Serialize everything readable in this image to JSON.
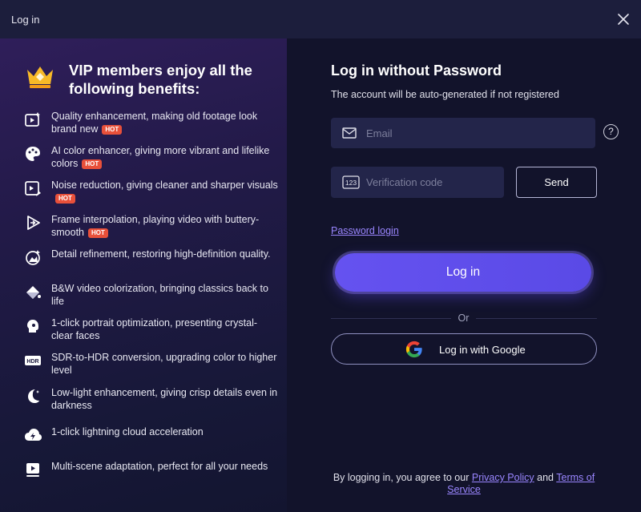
{
  "window": {
    "title": "Log in"
  },
  "benefits_panel": {
    "heading": "VIP members enjoy all the following benefits:",
    "hot_label": "HOT",
    "items": [
      {
        "icon": "video-enhance-icon",
        "text": "Quality enhancement, making old footage look brand new",
        "hot": true
      },
      {
        "icon": "palette-icon",
        "text": "AI color enhancer, giving more vibrant and lifelike colors",
        "hot": true
      },
      {
        "icon": "noise-reduction-icon",
        "text": "Noise reduction, giving cleaner and sharper visuals",
        "hot": true
      },
      {
        "icon": "frame-interpolation-icon",
        "text": "Frame interpolation, playing video with buttery-smooth",
        "hot": true
      },
      {
        "icon": "detail-refine-icon",
        "text": "Detail refinement, restoring high-definition quality.",
        "hot": false
      },
      {
        "icon": "colorize-icon",
        "text": "B&W video colorization, bringing classics back to life",
        "hot": false
      },
      {
        "icon": "portrait-icon",
        "text": "1-click portrait optimization, presenting crystal-clear faces",
        "hot": false
      },
      {
        "icon": "hdr-icon",
        "text": "SDR-to-HDR conversion, upgrading color to higher level",
        "hot": false
      },
      {
        "icon": "moon-icon",
        "text": "Low-light enhancement, giving crisp details even in darkness",
        "hot": false
      },
      {
        "icon": "cloud-lightning-icon",
        "text": "1-click lightning cloud acceleration",
        "hot": false
      },
      {
        "icon": "multi-scene-icon",
        "text": "Multi-scene adaptation, perfect for all your needs",
        "hot": false
      }
    ]
  },
  "login_panel": {
    "title": "Log in without Password",
    "subtitle": "The account will be auto-generated if not registered",
    "email": {
      "placeholder": "Email",
      "value": ""
    },
    "help_glyph": "?",
    "code": {
      "placeholder": "Verification code",
      "value": "",
      "icon_text": "123"
    },
    "send_label": "Send",
    "password_login_label": "Password login",
    "login_label": "Log in",
    "or_label": "Or",
    "google_label": "Log in with Google",
    "terms": {
      "prefix": "By logging in, you agree to our",
      "privacy": "Privacy Policy",
      "and": "and",
      "tos": "Terms of Service"
    }
  },
  "colors": {
    "accent": "#6552f0",
    "link": "#9a86ff",
    "hot_badge": "#e8503a",
    "panel_bg": "#12132b",
    "title_bar": "#1c1e3c"
  }
}
